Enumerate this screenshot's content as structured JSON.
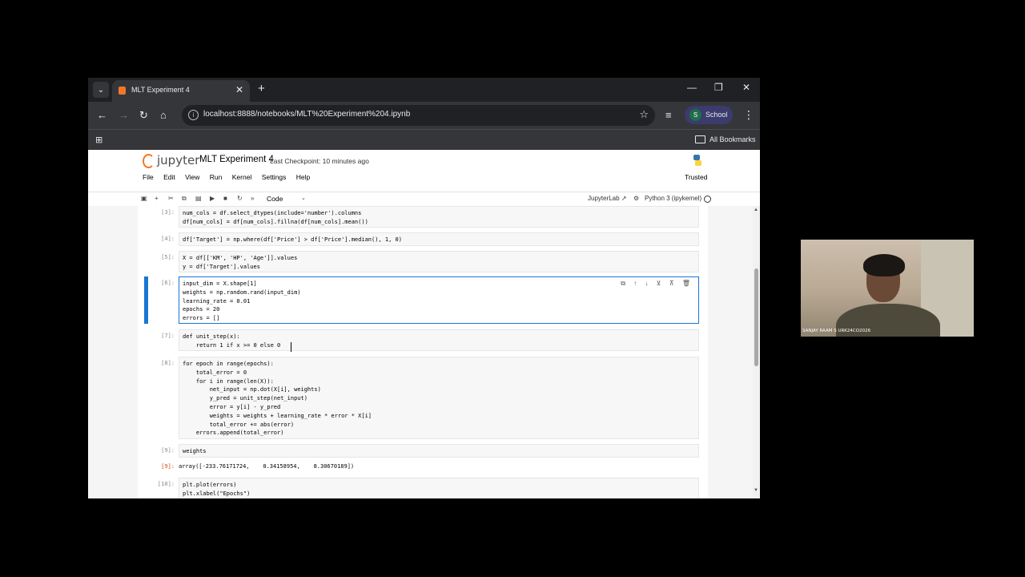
{
  "browser": {
    "tab_title": "MLT Experiment 4",
    "tab_close": "✕",
    "new_tab": "+",
    "url": "localhost:8888/notebooks/MLT%20Experiment%204.ipynb",
    "profile_initial": "S",
    "profile_name": "School",
    "bookmarks_label": "All Bookmarks",
    "accent": "#3c3b6e"
  },
  "jupyter": {
    "logo_text": "jupyter",
    "notebook_title": "MLT Experiment 4",
    "checkpoint": "Last Checkpoint: 10 minutes ago",
    "menu": [
      "File",
      "Edit",
      "View",
      "Run",
      "Kernel",
      "Settings",
      "Help"
    ],
    "trusted": "Trusted",
    "cell_type": "Code",
    "jupyterlab_link": "JupyterLab ↗",
    "kernel_name": "Python 3 (ipykernel)"
  },
  "cells": [
    {
      "prompt": "[3]:",
      "lines": [
        "num_cols = df.select_dtypes(include='number').columns",
        "df[num_cols] = df[num_cols].fillna(df[num_cols].mean())"
      ]
    },
    {
      "prompt": "[4]:",
      "lines": [
        "df['Target'] = np.where(df['Price'] > df['Price'].median(), 1, 0)"
      ]
    },
    {
      "prompt": "[5]:",
      "lines": [
        "X = df[['KM', 'HP', 'Age']].values",
        "y = df['Target'].values"
      ]
    },
    {
      "prompt": "[6]:",
      "lines": [
        "input_dim = X.shape[1]",
        "weights = np.random.rand(input_dim)",
        "learning_rate = 0.01",
        "epochs = 20",
        "errors = []"
      ]
    },
    {
      "prompt": "[7]:",
      "lines": [
        "def unit_step(x):",
        "    return 1 if x >= 0 else 0"
      ]
    },
    {
      "prompt": "[8]:",
      "lines": [
        "for epoch in range(epochs):",
        "    total_error = 0",
        "    for i in range(len(X)):",
        "        net_input = np.dot(X[i], weights)",
        "        y_pred = unit_step(net_input)",
        "        error = y[i] - y_pred",
        "        weights = weights + learning_rate * error * X[i]",
        "        total_error += abs(error)",
        "    errors.append(total_error)"
      ]
    },
    {
      "prompt": "[9]:",
      "lines": [
        "weights"
      ]
    },
    {
      "prompt": "[10]:",
      "lines": [
        "plt.plot(errors)",
        "plt.xlabel(\"Epochs\")"
      ]
    }
  ],
  "outputs": [
    {
      "prompt": "[9]:",
      "text": "array([-233.76171724,    0.34158954,    8.30670189])"
    }
  ],
  "webcam": {
    "label": "SANJAY RAAM S URK24CO2026"
  }
}
